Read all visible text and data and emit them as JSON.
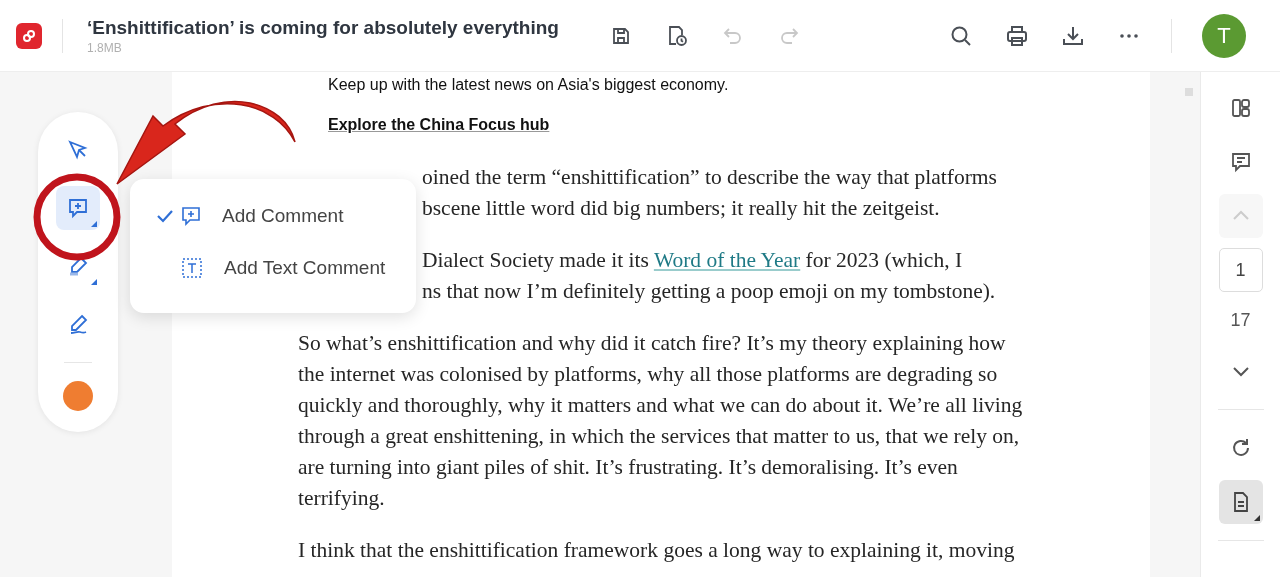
{
  "header": {
    "title": "‘Enshittification’ is coming for absolutely everything",
    "file_size": "1.8MB",
    "actions": [
      {
        "kind": "save",
        "disabled": false
      },
      {
        "kind": "history",
        "disabled": false
      },
      {
        "kind": "undo",
        "disabled": true
      },
      {
        "kind": "redo",
        "disabled": true
      }
    ],
    "tools": [
      {
        "kind": "search"
      },
      {
        "kind": "print"
      },
      {
        "kind": "download"
      },
      {
        "kind": "more"
      }
    ],
    "avatar": "T"
  },
  "toolbar": {
    "tools": [
      {
        "kind": "pointer",
        "selected": false,
        "has_menu": false
      },
      {
        "kind": "comment",
        "selected": true,
        "has_menu": true
      },
      {
        "kind": "highlighter",
        "selected": false,
        "has_menu": true
      },
      {
        "kind": "pen",
        "selected": false,
        "has_menu": false
      }
    ],
    "color": "#ef7d31"
  },
  "comment_menu": [
    {
      "kind": "comment",
      "label": "Add Comment",
      "selected": true
    },
    {
      "kind": "text_comment",
      "label": "Add Text Comment",
      "selected": false
    }
  ],
  "document": {
    "intro": "Keep up with the latest news on Asia's biggest economy.",
    "hub_link": "Explore the China Focus hub",
    "covered_lines": [
      [
        {
          "text": "oined the term “enshittification” to describe the way that platforms"
        }
      ],
      [
        {
          "text": "bscene little word did big numbers; it really hit the zeitgeist."
        }
      ],
      [
        {
          "text": "Dialect Society made it its "
        },
        {
          "text": "Word of the Year",
          "link": true
        },
        {
          "text": " for 2023 (which, I"
        }
      ],
      [
        {
          "text": "ns that now I’m definitely getting a poop emoji on my tombstone)."
        }
      ]
    ],
    "paragraphs": [
      "So what’s enshittification and why did it catch fire? It’s my theory explaining how the internet was colonised by platforms, why all those platforms are degrading so quickly and thoroughly, why it matters and what we can do about it. We’re all living through a great enshittening, in which the services that matter to us, that we rely on, are turning into giant piles of shit. It’s frustrating. It’s demoralising. It’s even terrifying.",
      "I think that the enshittification framework goes a long way to explaining it, moving"
    ]
  },
  "pager": {
    "current_page": "1",
    "total_pages": "17",
    "prev_disabled": true
  }
}
